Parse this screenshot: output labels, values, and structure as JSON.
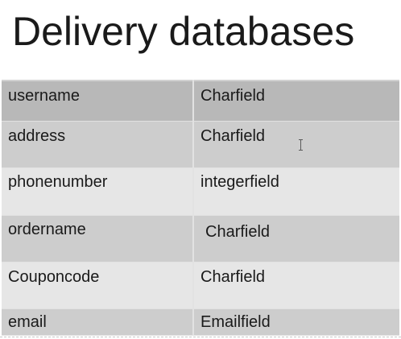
{
  "slide": {
    "title": "Delivery databases"
  },
  "table": {
    "rows": [
      {
        "name": "username",
        "type": "Charfield"
      },
      {
        "name": "address",
        "type": "Charfield"
      },
      {
        "name": "phonenumber",
        "type": "integerfield"
      },
      {
        "name": "ordername",
        "type": "Charfield"
      },
      {
        "name": "Couponcode",
        "type": "Charfield"
      },
      {
        "name": "email",
        "type": "Emailfield"
      }
    ]
  },
  "colors": {
    "row_dark": "#b8b8b8",
    "row_medium": "#cdcdcd",
    "row_light": "#e6e6e6",
    "text": "#1a1a1a"
  },
  "icons": {
    "cursor": "text-cursor-icon"
  }
}
